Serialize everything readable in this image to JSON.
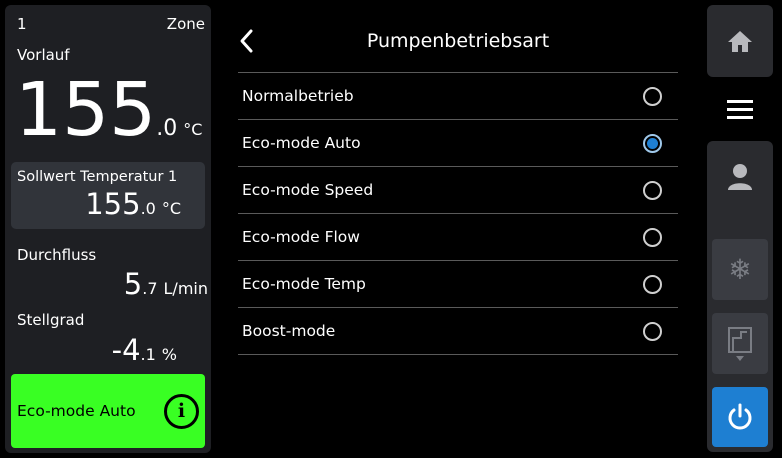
{
  "zone": {
    "number": "1",
    "label": "Zone"
  },
  "vorlauf": {
    "label": "Vorlauf",
    "value_int": "155",
    "value_dec": ".0",
    "unit": "°C"
  },
  "sollwert": {
    "label": "Sollwert Temperatur 1",
    "value_int": "155",
    "value_dec": ".0",
    "unit": "°C"
  },
  "durchfluss": {
    "label": "Durchfluss",
    "value_int": "5",
    "value_dec": ".7",
    "unit": "L/min"
  },
  "stellgrad": {
    "label": "Stellgrad",
    "value_int": "-4",
    "value_dec": ".1",
    "unit": "%"
  },
  "status": {
    "label": "Eco-mode Auto",
    "color": "#39ff23"
  },
  "header": {
    "title": "Pumpenbetriebsart"
  },
  "options": [
    {
      "label": "Normalbetrieb",
      "selected": false
    },
    {
      "label": "Eco-mode Auto",
      "selected": true
    },
    {
      "label": "Eco-mode Speed",
      "selected": false
    },
    {
      "label": "Eco-mode Flow",
      "selected": false
    },
    {
      "label": "Eco-mode Temp",
      "selected": false
    },
    {
      "label": "Boost-mode",
      "selected": false
    }
  ],
  "nav": {
    "icons": [
      "home-icon",
      "menu-icon",
      "user-icon",
      "snowflake-icon",
      "door-icon",
      "power-icon"
    ],
    "snowflake_glyph": "❄",
    "accent_color": "#1e7fd2"
  }
}
